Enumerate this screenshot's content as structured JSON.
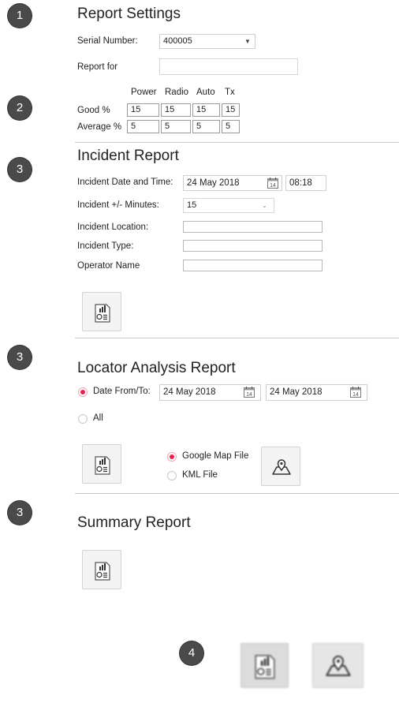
{
  "badges": [
    "1",
    "2",
    "3",
    "3",
    "3",
    "4"
  ],
  "report_settings": {
    "title": "Report Settings",
    "serial_label": "Serial Number:",
    "serial_value": "400005",
    "report_for_label": "Report for",
    "report_for_value": "",
    "columns": [
      "Power",
      "Radio",
      "Auto",
      "Tx"
    ],
    "rows": [
      {
        "label": "Good %",
        "values": [
          "15",
          "15",
          "15",
          "15"
        ]
      },
      {
        "label": "Average %",
        "values": [
          "5",
          "5",
          "5",
          "5"
        ]
      }
    ]
  },
  "incident_report": {
    "title": "Incident Report",
    "date_time_label": "Incident Date and Time:",
    "date_value": "24 May 2018",
    "time_value": "08:18",
    "calendar_day": "14",
    "minutes_label": "Incident +/- Minutes:",
    "minutes_value": "15",
    "location_label": "Incident Location:",
    "location_value": "",
    "type_label": "Incident Type:",
    "type_value": "",
    "operator_label": "Operator Name",
    "operator_value": "",
    "button_icon": "report-chart-icon"
  },
  "locator_report": {
    "title": "Locator Analysis Report",
    "date_range_label": "Date From/To:",
    "from_value": "24 May 2018",
    "to_value": "24 May 2018",
    "calendar_day": "14",
    "all_label": "All",
    "date_range_selected": true,
    "google_map_label": "Google Map File",
    "kml_label": "KML File",
    "google_map_selected": true,
    "report_icon": "report-chart-icon",
    "map_icon": "map-pin-icon"
  },
  "summary_report": {
    "title": "Summary Report",
    "button_icon": "report-chart-icon"
  },
  "legend_icons": [
    "report-chart-icon",
    "map-pin-icon"
  ],
  "colors": {
    "badge": "#4a4a4a",
    "radio_selected": "#e8214f",
    "divider": "#c9c9c9",
    "button_bg": "#f4f4f4"
  }
}
